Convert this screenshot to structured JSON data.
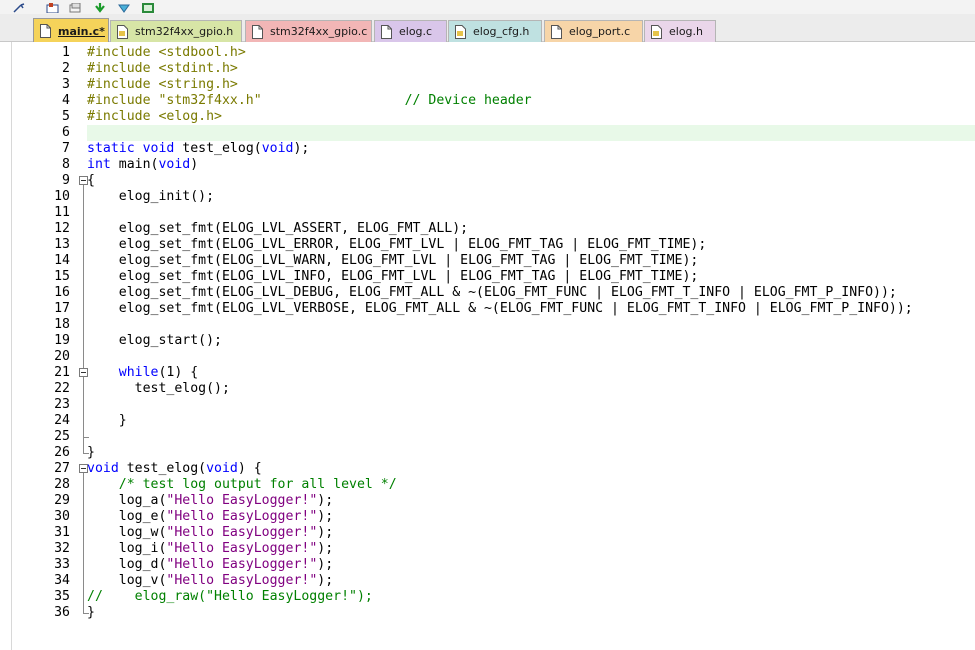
{
  "tabs": [
    {
      "label": "main.c*",
      "active": true,
      "color": "#f5d35a",
      "icon": "c-file-icon"
    },
    {
      "label": "stm32f4xx_gpio.h",
      "active": false,
      "color": "#d7e5a6",
      "icon": "h-file-icon"
    },
    {
      "label": "stm32f4xx_gpio.c",
      "active": false,
      "color": "#f2b6b6",
      "icon": "c-file-icon"
    },
    {
      "label": "elog.c",
      "active": false,
      "color": "#d9c6ea",
      "icon": "c-file-icon"
    },
    {
      "label": "elog_cfg.h",
      "active": false,
      "color": "#bfe1e1",
      "icon": "h-file-icon"
    },
    {
      "label": "elog_port.c",
      "active": false,
      "color": "#f7d5a8",
      "icon": "c-file-icon"
    },
    {
      "label": "elog.h",
      "active": false,
      "color": "#ead6ea",
      "icon": "h-file-icon"
    }
  ],
  "editor": {
    "highlighted_line": 6,
    "lines": [
      [
        {
          "t": "#include <stdbool.h>",
          "c": "pp"
        }
      ],
      [
        {
          "t": "#include <stdint.h>",
          "c": "pp"
        }
      ],
      [
        {
          "t": "#include <string.h>",
          "c": "pp"
        }
      ],
      [
        {
          "t": "#include \"stm32f4xx.h\"",
          "c": "pp"
        },
        {
          "t": "                  "
        },
        {
          "t": "// Device header",
          "c": "cm"
        }
      ],
      [
        {
          "t": "#include <elog.h>",
          "c": "pp"
        }
      ],
      [],
      [
        {
          "t": "static",
          "c": "kw"
        },
        {
          "t": " "
        },
        {
          "t": "void",
          "c": "kw"
        },
        {
          "t": " test_elog("
        },
        {
          "t": "void",
          "c": "kw"
        },
        {
          "t": ");"
        }
      ],
      [
        {
          "t": "int",
          "c": "kw"
        },
        {
          "t": " main("
        },
        {
          "t": "void",
          "c": "kw"
        },
        {
          "t": ")"
        }
      ],
      [
        {
          "t": "{"
        }
      ],
      [
        {
          "t": "    elog_init();"
        }
      ],
      [],
      [
        {
          "t": "    elog_set_fmt(ELOG_LVL_ASSERT, ELOG_FMT_ALL);"
        }
      ],
      [
        {
          "t": "    elog_set_fmt(ELOG_LVL_ERROR, ELOG_FMT_LVL | ELOG_FMT_TAG | ELOG_FMT_TIME);"
        }
      ],
      [
        {
          "t": "    elog_set_fmt(ELOG_LVL_WARN, ELOG_FMT_LVL | ELOG_FMT_TAG | ELOG_FMT_TIME);"
        }
      ],
      [
        {
          "t": "    elog_set_fmt(ELOG_LVL_INFO, ELOG_FMT_LVL | ELOG_FMT_TAG | ELOG_FMT_TIME);"
        }
      ],
      [
        {
          "t": "    elog_set_fmt(ELOG_LVL_DEBUG, ELOG_FMT_ALL & ~(ELOG_FMT_FUNC | ELOG_FMT_T_INFO | ELOG_FMT_P_INFO));"
        }
      ],
      [
        {
          "t": "    elog_set_fmt(ELOG_LVL_VERBOSE, ELOG_FMT_ALL & ~(ELOG_FMT_FUNC | ELOG_FMT_T_INFO | ELOG_FMT_P_INFO));"
        }
      ],
      [],
      [
        {
          "t": "    elog_start();"
        }
      ],
      [],
      [
        {
          "t": "    "
        },
        {
          "t": "while",
          "c": "kw"
        },
        {
          "t": "(1) {"
        }
      ],
      [
        {
          "t": "      test_elog();"
        }
      ],
      [],
      [
        {
          "t": "    }"
        }
      ],
      [],
      [
        {
          "t": "}"
        }
      ],
      [
        {
          "t": "void",
          "c": "kw"
        },
        {
          "t": " test_elog("
        },
        {
          "t": "void",
          "c": "kw"
        },
        {
          "t": ") {"
        }
      ],
      [
        {
          "t": "    "
        },
        {
          "t": "/* test log output for all level */",
          "c": "cm"
        }
      ],
      [
        {
          "t": "    log_a("
        },
        {
          "t": "\"Hello EasyLogger!\"",
          "c": "st"
        },
        {
          "t": ");"
        }
      ],
      [
        {
          "t": "    log_e("
        },
        {
          "t": "\"Hello EasyLogger!\"",
          "c": "st"
        },
        {
          "t": ");"
        }
      ],
      [
        {
          "t": "    log_w("
        },
        {
          "t": "\"Hello EasyLogger!\"",
          "c": "st"
        },
        {
          "t": ");"
        }
      ],
      [
        {
          "t": "    log_i("
        },
        {
          "t": "\"Hello EasyLogger!\"",
          "c": "st"
        },
        {
          "t": ");"
        }
      ],
      [
        {
          "t": "    log_d("
        },
        {
          "t": "\"Hello EasyLogger!\"",
          "c": "st"
        },
        {
          "t": ");"
        }
      ],
      [
        {
          "t": "    log_v("
        },
        {
          "t": "\"Hello EasyLogger!\"",
          "c": "st"
        },
        {
          "t": ");"
        }
      ],
      [
        {
          "t": "//    elog_raw(\"Hello EasyLogger!\");",
          "c": "cm"
        }
      ],
      [
        {
          "t": "}"
        }
      ]
    ],
    "fold_markers": [
      9,
      21,
      27
    ],
    "fold_ranges": [
      [
        9,
        26
      ],
      [
        21,
        25
      ],
      [
        27,
        36
      ]
    ]
  },
  "colors": {
    "preprocessor": "#7a7a00",
    "keyword": "#0000ff",
    "comment": "#008000",
    "string": "#800080",
    "current_line": "#e8f9e8"
  }
}
